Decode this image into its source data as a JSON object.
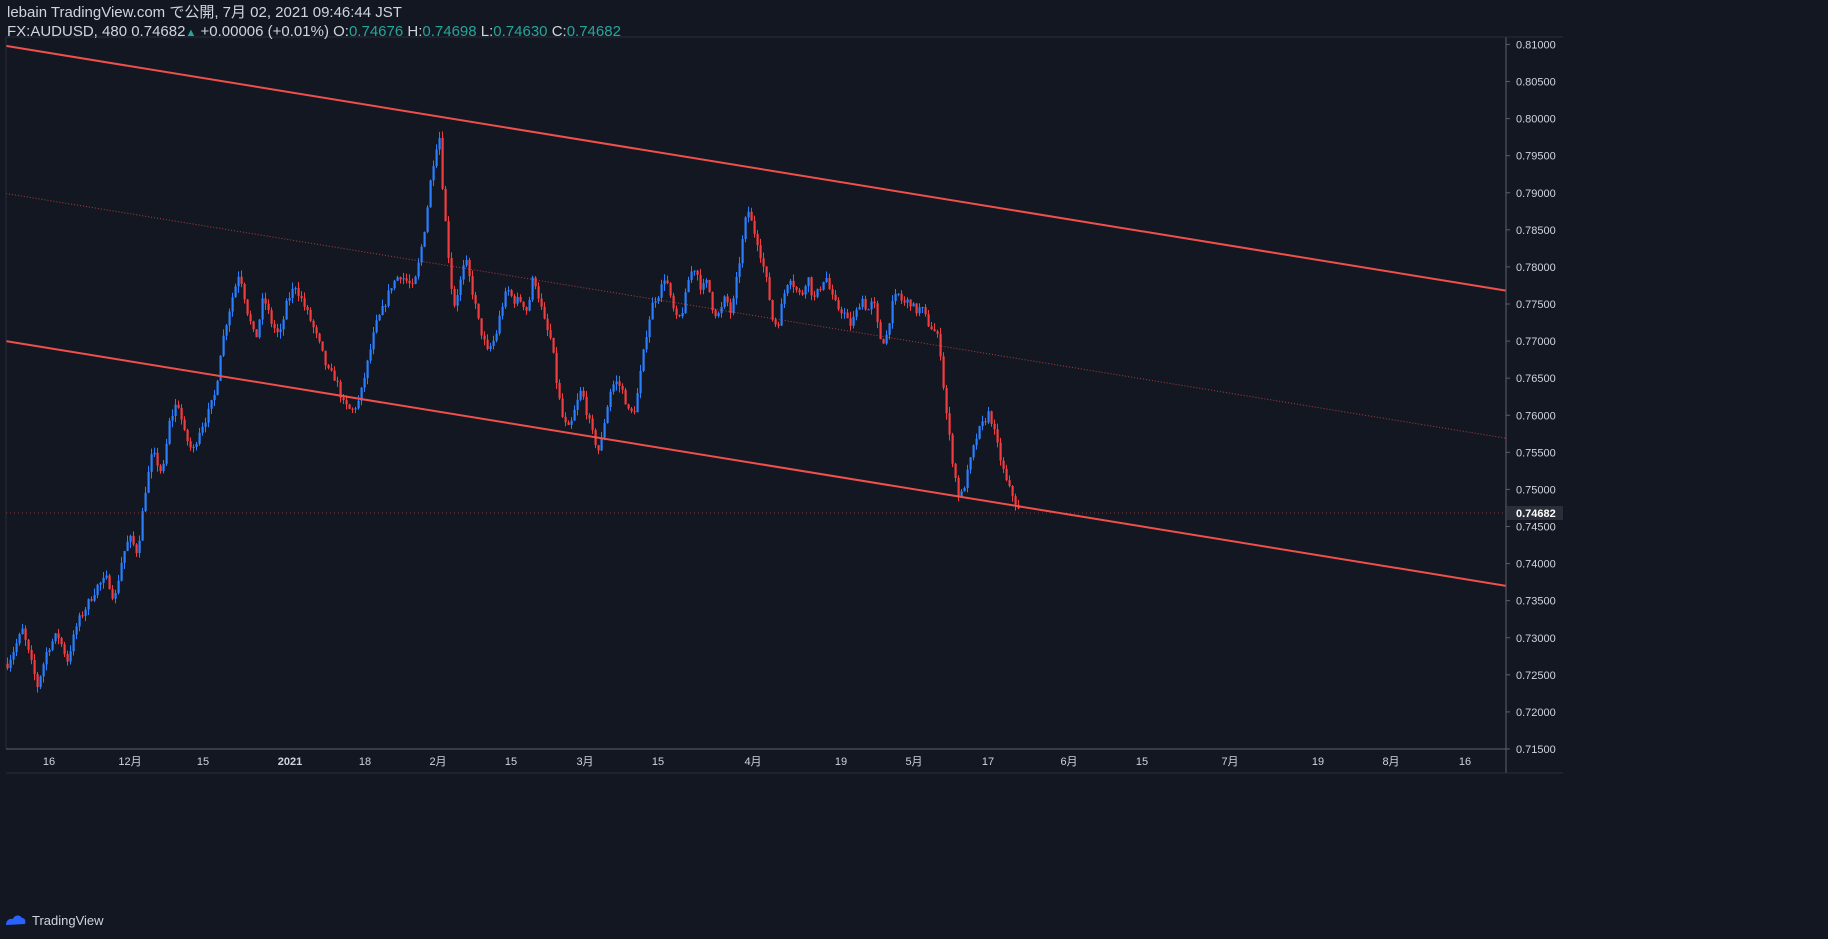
{
  "header": {
    "line1": "lebain TradingView.com で公開, 7月 02, 2021 09:46:44 JST",
    "symbol": "FX:AUDUSD, 480",
    "last": "0.74682",
    "change": "+0.00006 (+0.01%)",
    "o_label": "O:",
    "o_value": "0.74676",
    "h_label": "H:",
    "h_value": "0.74698",
    "l_label": "L:",
    "l_value": "0.74630",
    "c_label": "C:",
    "c_value": "0.74682"
  },
  "footer": {
    "brand": "TradingView"
  },
  "colors": {
    "background": "#131722",
    "up": "#2a7fff",
    "down": "#f23d40",
    "channel": "#f0504b",
    "text": "#d1d4dc",
    "green": "#26a69a"
  },
  "chart_data": {
    "type": "candlestick",
    "symbol": "FX:AUDUSD",
    "interval": "480",
    "x_tick_labels": [
      "16",
      "12月",
      "15",
      "2021",
      "18",
      "2月",
      "15",
      "3月",
      "15",
      "4月",
      "19",
      "5月",
      "17",
      "6月",
      "15",
      "7月",
      "19",
      "8月",
      "16"
    ],
    "y_tick_labels": [
      "0.81000",
      "0.80500",
      "0.80000",
      "0.79500",
      "0.79000",
      "0.78500",
      "0.78000",
      "0.77500",
      "0.77000",
      "0.76500",
      "0.76000",
      "0.75500",
      "0.75000",
      "0.74500",
      "0.74000",
      "0.73500",
      "0.73000",
      "0.72500",
      "0.72000",
      "0.71500"
    ],
    "ylim": [
      0.715,
      0.811
    ],
    "last_price": "0.74682",
    "price_path": [
      [
        0,
        0.7265
      ],
      [
        15,
        0.731
      ],
      [
        25,
        0.726
      ],
      [
        30,
        0.7235
      ],
      [
        40,
        0.7285
      ],
      [
        50,
        0.7305
      ],
      [
        60,
        0.727
      ],
      [
        70,
        0.732
      ],
      [
        80,
        0.7345
      ],
      [
        90,
        0.737
      ],
      [
        100,
        0.738
      ],
      [
        107,
        0.735
      ],
      [
        115,
        0.741
      ],
      [
        122,
        0.7435
      ],
      [
        130,
        0.7415
      ],
      [
        138,
        0.75
      ],
      [
        145,
        0.755
      ],
      [
        155,
        0.752
      ],
      [
        162,
        0.759
      ],
      [
        170,
        0.762
      ],
      [
        177,
        0.7575
      ],
      [
        185,
        0.755
      ],
      [
        192,
        0.758
      ],
      [
        200,
        0.76
      ],
      [
        208,
        0.763
      ],
      [
        213,
        0.7685
      ],
      [
        218,
        0.772
      ],
      [
        225,
        0.776
      ],
      [
        232,
        0.7795
      ],
      [
        240,
        0.774
      ],
      [
        248,
        0.77
      ],
      [
        256,
        0.776
      ],
      [
        264,
        0.7725
      ],
      [
        272,
        0.7705
      ],
      [
        280,
        0.7755
      ],
      [
        288,
        0.7775
      ],
      [
        296,
        0.775
      ],
      [
        304,
        0.7725
      ],
      [
        312,
        0.7695
      ],
      [
        320,
        0.766
      ],
      [
        328,
        0.765
      ],
      [
        336,
        0.7615
      ],
      [
        344,
        0.7605
      ],
      [
        352,
        0.762
      ],
      [
        360,
        0.767
      ],
      [
        368,
        0.772
      ],
      [
        376,
        0.7745
      ],
      [
        384,
        0.7775
      ],
      [
        392,
        0.779
      ],
      [
        400,
        0.778
      ],
      [
        406,
        0.777
      ],
      [
        412,
        0.781
      ],
      [
        418,
        0.786
      ],
      [
        423,
        0.7915
      ],
      [
        428,
        0.796
      ],
      [
        432,
        0.7975
      ],
      [
        436,
        0.789
      ],
      [
        440,
        0.783
      ],
      [
        446,
        0.7745
      ],
      [
        452,
        0.7775
      ],
      [
        458,
        0.781
      ],
      [
        466,
        0.776
      ],
      [
        472,
        0.772
      ],
      [
        480,
        0.7685
      ],
      [
        488,
        0.7705
      ],
      [
        494,
        0.7745
      ],
      [
        500,
        0.777
      ],
      [
        506,
        0.7755
      ],
      [
        514,
        0.7755
      ],
      [
        520,
        0.774
      ],
      [
        526,
        0.779
      ],
      [
        532,
        0.7755
      ],
      [
        538,
        0.772
      ],
      [
        544,
        0.77
      ],
      [
        550,
        0.7635
      ],
      [
        556,
        0.759
      ],
      [
        562,
        0.758
      ],
      [
        568,
        0.761
      ],
      [
        574,
        0.7635
      ],
      [
        580,
        0.76
      ],
      [
        586,
        0.757
      ],
      [
        592,
        0.755
      ],
      [
        598,
        0.76
      ],
      [
        604,
        0.764
      ],
      [
        610,
        0.7645
      ],
      [
        616,
        0.763
      ],
      [
        622,
        0.76
      ],
      [
        628,
        0.761
      ],
      [
        634,
        0.7665
      ],
      [
        640,
        0.772
      ],
      [
        646,
        0.7755
      ],
      [
        652,
        0.7765
      ],
      [
        658,
        0.779
      ],
      [
        664,
        0.775
      ],
      [
        670,
        0.7725
      ],
      [
        676,
        0.7745
      ],
      [
        682,
        0.779
      ],
      [
        688,
        0.78
      ],
      [
        694,
        0.777
      ],
      [
        700,
        0.778
      ],
      [
        706,
        0.774
      ],
      [
        712,
        0.7735
      ],
      [
        718,
        0.776
      ],
      [
        724,
        0.7735
      ],
      [
        730,
        0.779
      ],
      [
        735,
        0.7835
      ],
      [
        740,
        0.788
      ],
      [
        745,
        0.7855
      ],
      [
        750,
        0.7835
      ],
      [
        756,
        0.78
      ],
      [
        760,
        0.7775
      ],
      [
        765,
        0.773
      ],
      [
        770,
        0.772
      ],
      [
        776,
        0.776
      ],
      [
        782,
        0.779
      ],
      [
        788,
        0.777
      ],
      [
        794,
        0.776
      ],
      [
        800,
        0.779
      ],
      [
        806,
        0.7755
      ],
      [
        812,
        0.777
      ],
      [
        818,
        0.779
      ],
      [
        824,
        0.776
      ],
      [
        830,
        0.7745
      ],
      [
        836,
        0.774
      ],
      [
        842,
        0.772
      ],
      [
        848,
        0.7735
      ],
      [
        854,
        0.776
      ],
      [
        860,
        0.774
      ],
      [
        866,
        0.7755
      ],
      [
        872,
        0.7705
      ],
      [
        878,
        0.77
      ],
      [
        884,
        0.7745
      ],
      [
        890,
        0.7765
      ],
      [
        896,
        0.775
      ],
      [
        902,
        0.7755
      ],
      [
        908,
        0.774
      ],
      [
        914,
        0.7745
      ],
      [
        920,
        0.7725
      ],
      [
        926,
        0.7715
      ],
      [
        932,
        0.77
      ],
      [
        936,
        0.764
      ],
      [
        940,
        0.759
      ],
      [
        946,
        0.753
      ],
      [
        952,
        0.7485
      ],
      [
        958,
        0.751
      ],
      [
        964,
        0.7545
      ],
      [
        970,
        0.7575
      ],
      [
        976,
        0.759
      ],
      [
        982,
        0.7605
      ],
      [
        988,
        0.757
      ],
      [
        994,
        0.7535
      ],
      [
        1000,
        0.7505
      ],
      [
        1006,
        0.749
      ],
      [
        1012,
        0.7468
      ]
    ],
    "channel_lines": [
      {
        "name": "upper",
        "x": [
          0,
          1500
        ],
        "y": [
          0.8098,
          0.7768
        ],
        "style": "solid"
      },
      {
        "name": "lower",
        "x": [
          0,
          1500
        ],
        "y": [
          0.77,
          0.737
        ],
        "style": "solid"
      },
      {
        "name": "mid",
        "x": [
          0,
          1500
        ],
        "y": [
          0.7899,
          0.7569
        ],
        "style": "dotted"
      }
    ]
  }
}
